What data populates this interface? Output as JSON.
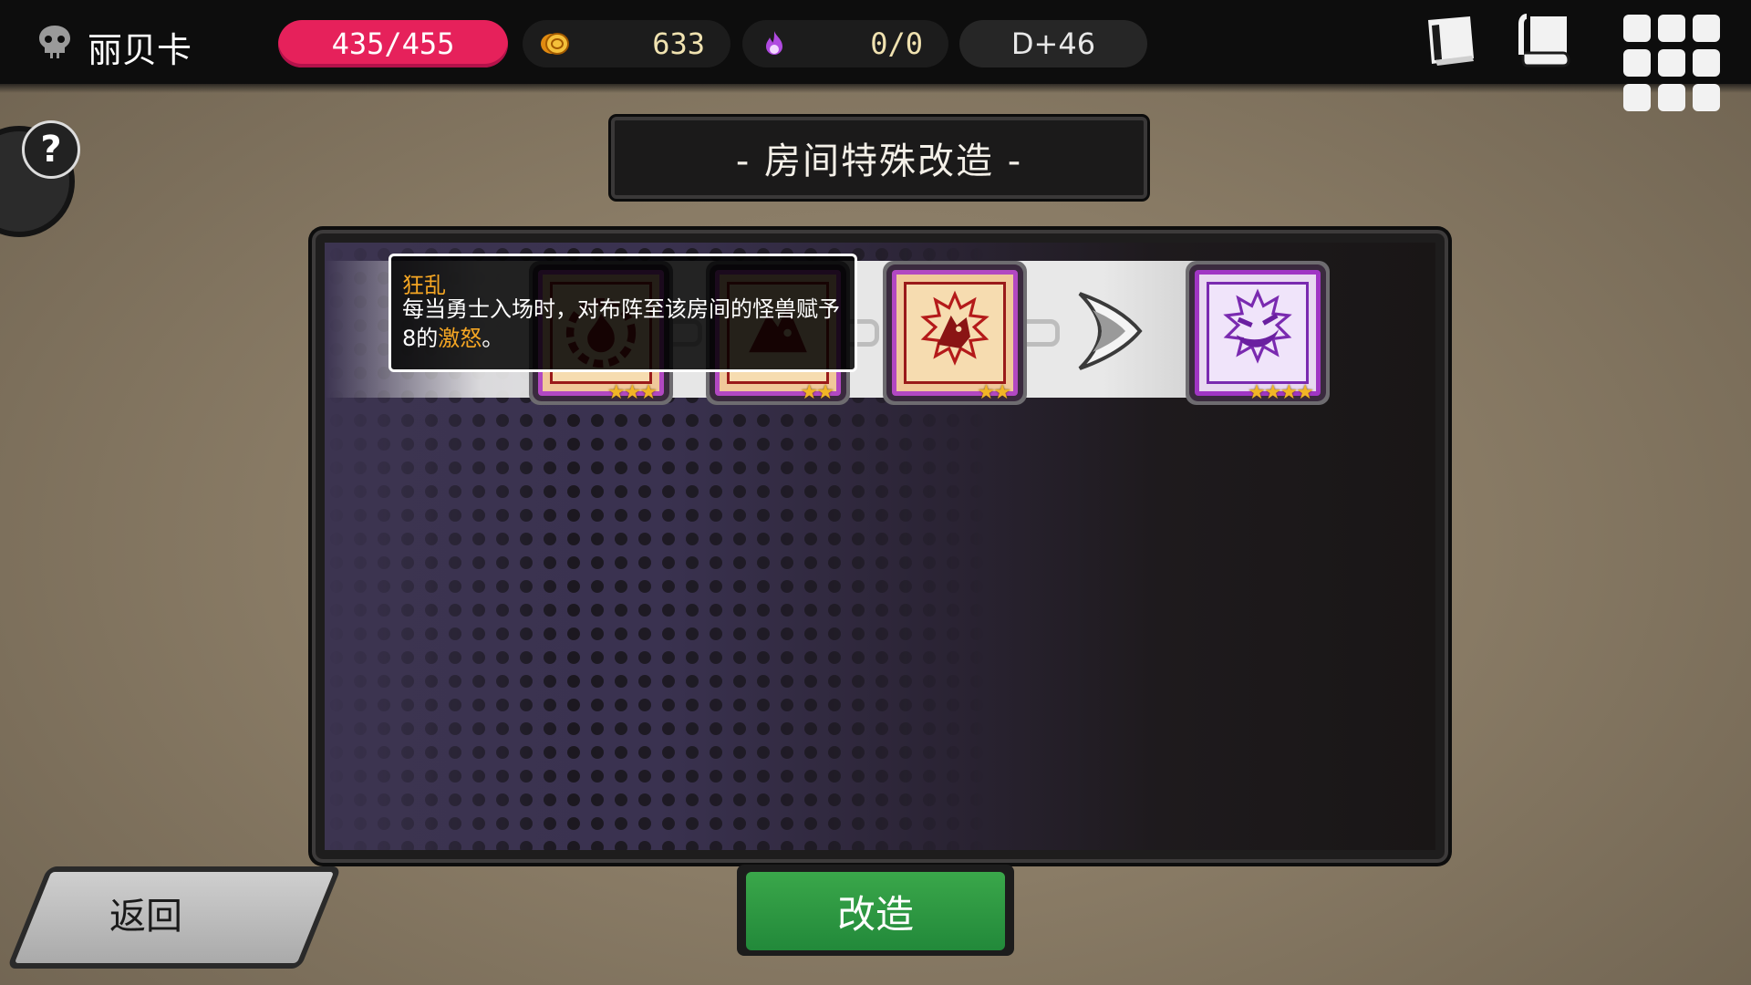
{
  "top_bar": {
    "player_name": "丽贝卡",
    "hp": "435/455",
    "gold": "633",
    "mana": "0/0",
    "day": "D+46",
    "icons": [
      "skull-icon",
      "gold-coin-icon",
      "purple-flame-icon",
      "journal-icon",
      "scroll-icon",
      "grid-menu-icon"
    ]
  },
  "title": "- 房间特殊改造 -",
  "upgrade_path": {
    "cards": [
      {
        "icon": "gear-flame-emblem-icon",
        "stars": 3
      },
      {
        "icon": "flame-wolf-emblem-icon",
        "stars": 2
      },
      {
        "icon": "fire-wolf-emblem-icon",
        "stars": 2
      },
      {
        "icon": "frenzy-grin-emblem-icon",
        "stars": 4
      }
    ],
    "arrow_icon": "chevron-right-icon"
  },
  "tooltip": {
    "title": "狂乱",
    "body_prefix": "每当勇士入场时，对布阵至该房间的怪兽赋予8的",
    "keyword": "激怒",
    "body_suffix": "。"
  },
  "buttons": {
    "back": "返回",
    "reform": "改造"
  },
  "colors": {
    "hp_pill": "#e6215b",
    "reform_button": "#2e9a40",
    "star": "#f2b526",
    "keyword": "#f5a623",
    "card_border": "#b248c2"
  }
}
